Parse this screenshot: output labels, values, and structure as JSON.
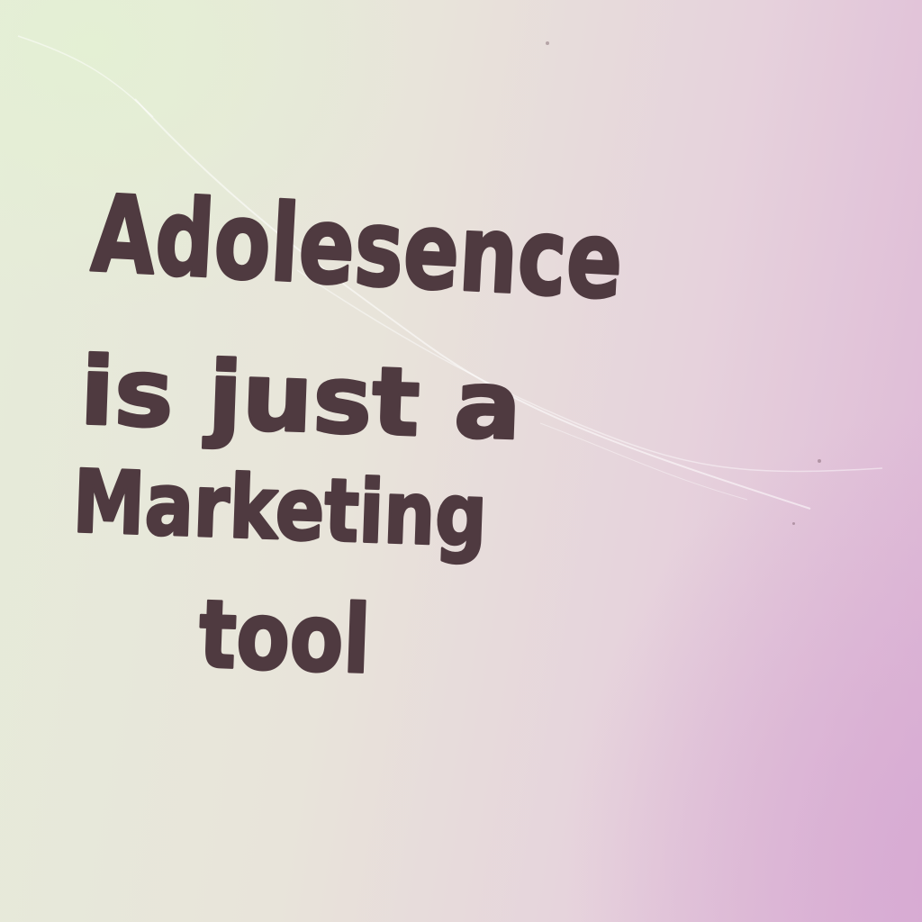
{
  "note": {
    "lines": [
      "Adolesence",
      "is just a",
      "Marketing",
      "tool"
    ]
  },
  "colors": {
    "ink": "#4f3a40",
    "paper_light": "#e6ecd9",
    "paper_pink": "#ddb6d6"
  }
}
